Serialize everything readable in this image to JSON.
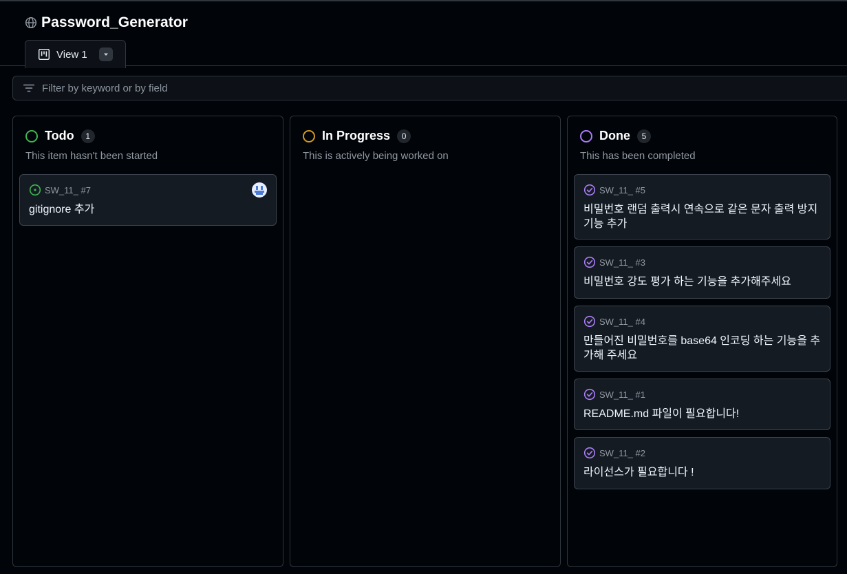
{
  "project": {
    "title": "Password_Generator",
    "icon": "globe-icon"
  },
  "view_tab": {
    "label": "View 1",
    "icon": "board-icon"
  },
  "filter": {
    "placeholder": "Filter by keyword or by field",
    "value": ""
  },
  "colors": {
    "todo": "#3fb950",
    "in_progress": "#d29922",
    "done": "#ab7df8"
  },
  "columns": [
    {
      "title": "Todo",
      "count": "1",
      "description": "This item hasn't been started",
      "cards": [
        {
          "ref": "SW_11_ #7",
          "title": "gitignore 추가",
          "state": "open",
          "has_avatar": true
        }
      ]
    },
    {
      "title": "In Progress",
      "count": "0",
      "description": "This is actively being worked on",
      "cards": []
    },
    {
      "title": "Done",
      "count": "5",
      "description": "This has been completed",
      "cards": [
        {
          "ref": "SW_11_ #5",
          "title": "비밀번호 랜덤 출력시 연속으로 같은 문자 출력 방지 기능 추가",
          "state": "closed"
        },
        {
          "ref": "SW_11_ #3",
          "title": "비밀번호 강도 평가 하는 기능을 추가해주세요",
          "state": "closed"
        },
        {
          "ref": "SW_11_ #4",
          "title": "만들어진 비밀번호를 base64 인코딩 하는 기능을 추가해 주세요",
          "state": "closed"
        },
        {
          "ref": "SW_11_ #1",
          "title": "README.md 파일이 필요합니다!",
          "state": "closed"
        },
        {
          "ref": "SW_11_ #2",
          "title": "라이선스가 필요합니다 !",
          "state": "closed"
        }
      ]
    }
  ]
}
